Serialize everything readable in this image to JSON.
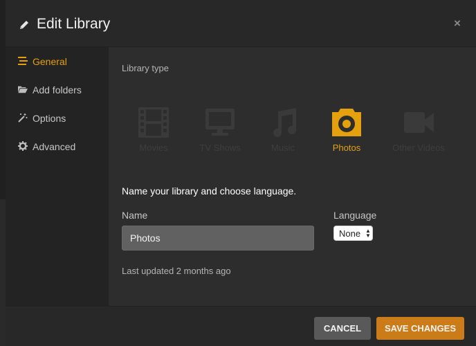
{
  "header": {
    "title": "Edit Library",
    "edit_icon": "pencil-icon",
    "close_label": "×"
  },
  "sidebar": {
    "items": [
      {
        "label": "General",
        "icon": "list-icon",
        "active": true
      },
      {
        "label": "Add folders",
        "icon": "folder-open-icon",
        "active": false
      },
      {
        "label": "Options",
        "icon": "magic-wand-icon",
        "active": false
      },
      {
        "label": "Advanced",
        "icon": "gear-icon",
        "active": false
      }
    ]
  },
  "main": {
    "library_type_label": "Library type",
    "types": [
      {
        "label": "Movies",
        "icon": "film-icon",
        "selected": false
      },
      {
        "label": "TV Shows",
        "icon": "tv-icon",
        "selected": false
      },
      {
        "label": "Music",
        "icon": "music-note-icon",
        "selected": false
      },
      {
        "label": "Photos",
        "icon": "camera-icon",
        "selected": true
      },
      {
        "label": "Other Videos",
        "icon": "video-camera-icon",
        "selected": false
      }
    ],
    "prompt": "Name your library and choose language.",
    "name_label": "Name",
    "name_value": "Photos",
    "language_label": "Language",
    "language_value": "None",
    "last_updated": "Last updated 2 months ago"
  },
  "footer": {
    "cancel_label": "CANCEL",
    "save_label": "SAVE CHANGES"
  },
  "colors": {
    "accent": "#e5a00d",
    "save_button": "#cc7b19",
    "cancel_button": "#595959",
    "inactive_type": "#3e3e3e"
  }
}
